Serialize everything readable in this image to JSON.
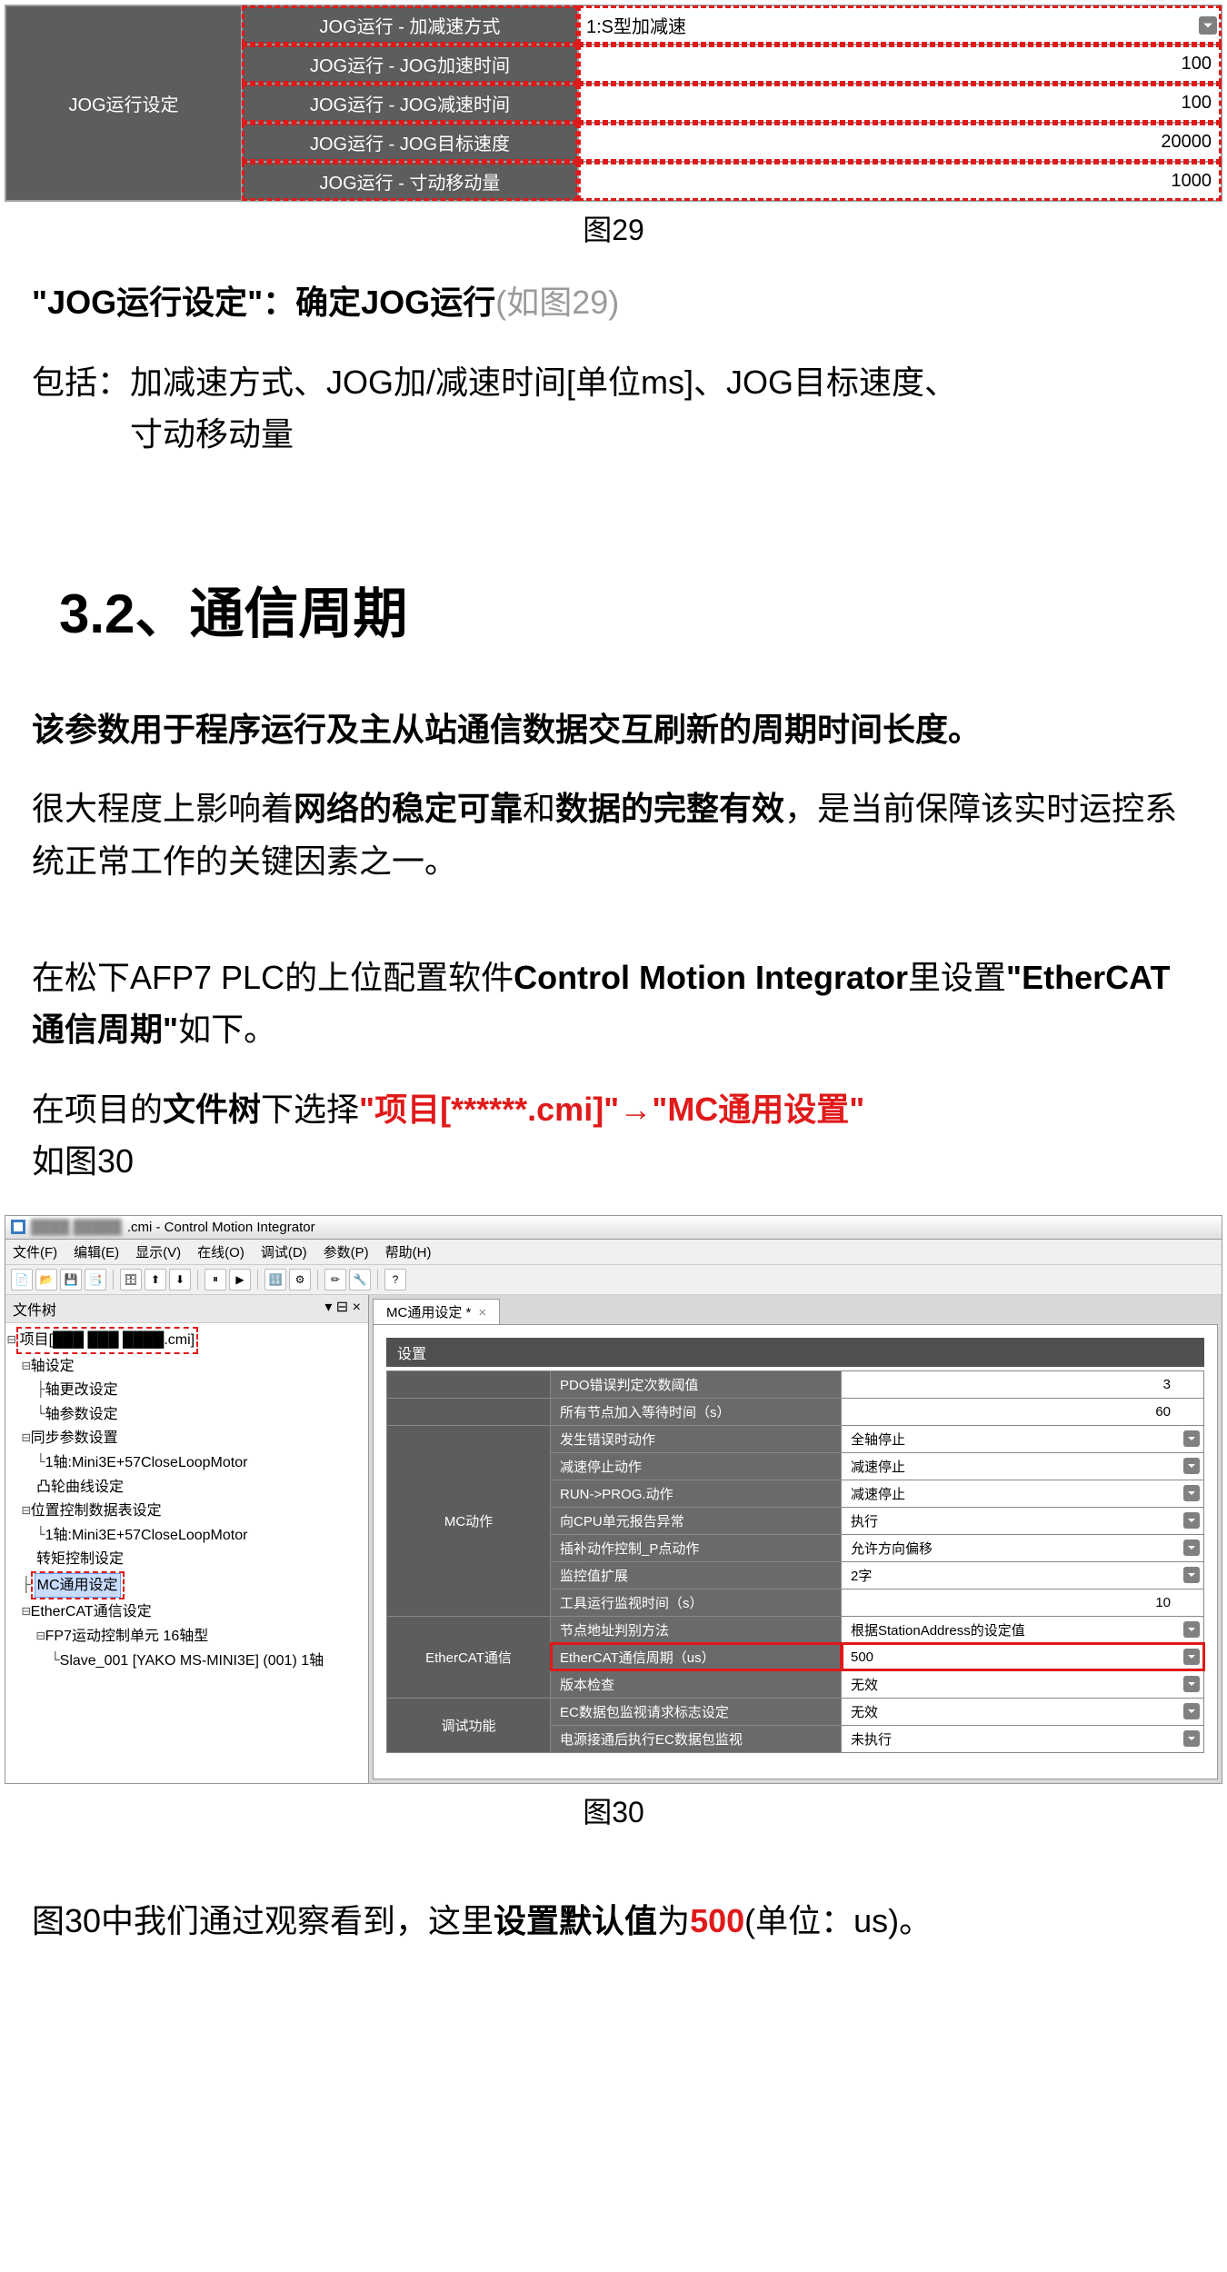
{
  "fig29": {
    "groupLabel": "JOG运行设定",
    "rows": [
      {
        "label": "JOG运行 - 加减速方式",
        "value": "1:S型加减速",
        "align": "left",
        "dd": true
      },
      {
        "label": "JOG运行 - JOG加速时间",
        "value": "100",
        "align": "right"
      },
      {
        "label": "JOG运行 - JOG减速时间",
        "value": "100",
        "align": "right"
      },
      {
        "label": "JOG运行 - JOG目标速度",
        "value": "20000",
        "align": "right"
      },
      {
        "label": "JOG运行 - 寸动移动量",
        "value": "1000",
        "align": "right"
      }
    ],
    "caption": "图29"
  },
  "text": {
    "p1_bold": "\"JOG运行设定\"：确定JOG运行",
    "p1_gray": "(如图29)",
    "p2": "包括：加减速方式、JOG加/减速时间[单位ms]、JOG目标速度、",
    "p2b": "　　　寸动移动量",
    "h2": "3.2、通信周期",
    "p3": "该参数用于程序运行及主从站通信数据交互刷新的周期时间长度。",
    "p4a": "很大程度上影响着",
    "p4b": "网络的稳定可靠",
    "p4c": "和",
    "p4d": "数据的完整有效",
    "p4e": "，是当前保障该实时运控系统正常工作的关键因素之一。",
    "p5a": "在松下AFP7 PLC的上位配置软件",
    "p5b": "Control Motion Integrator",
    "p5c": "里设置",
    "p5d": "\"EtherCAT通信周期\"",
    "p5e": "如下。",
    "p6a": "在项目的",
    "p6b": "文件树",
    "p6c": "下选择",
    "p6d": "\"项目[******.cmi]\"→\"MC通用设置\"",
    "p6e": "如图30",
    "cap30": "图30",
    "p7a": "图30中我们通过观察看到，这里",
    "p7b": "设置默认值",
    "p7c": "为",
    "p7d": "500",
    "p7e": "(单位：us)。"
  },
  "fig30": {
    "title": ".cmi - Control Motion Integrator",
    "titleBlur": "████ █████",
    "menus": [
      "文件(F)",
      "编辑(E)",
      "显示(V)",
      "在线(O)",
      "调试(D)",
      "参数(P)",
      "帮助(H)"
    ],
    "treeHeader": "文件树",
    "treePin": "▾ ⊟ ×",
    "tree": [
      {
        "ind": "⊟ ",
        "txt": "项目[███ ███ ████.cmi]",
        "box": true
      },
      {
        "ind": "　⊟ ",
        "txt": "轴设定"
      },
      {
        "ind": "　　├ ",
        "txt": "轴更改设定"
      },
      {
        "ind": "　　└ ",
        "txt": "轴参数设定"
      },
      {
        "ind": "　⊟ ",
        "txt": "同步参数设置"
      },
      {
        "ind": "　　└ ",
        "txt": "1轴:Mini3E+57CloseLoopMotor"
      },
      {
        "ind": "　　",
        "txt": "凸轮曲线设定"
      },
      {
        "ind": "　⊟ ",
        "txt": "位置控制数据表设定"
      },
      {
        "ind": "　　└ ",
        "txt": "1轴:Mini3E+57CloseLoopMotor"
      },
      {
        "ind": "　　",
        "txt": "转矩控制设定"
      },
      {
        "ind": "　├ ",
        "txt": "MC通用设定",
        "box": true,
        "hl": true
      },
      {
        "ind": "　⊟ ",
        "txt": "EtherCAT通信设定"
      },
      {
        "ind": "　　⊟ ",
        "txt": "FP7运动控制单元 16轴型"
      },
      {
        "ind": "　　　└ ",
        "txt": "Slave_001 [YAKO MS-MINI3E] (001) 1轴"
      }
    ],
    "tabTitle": "MC通用设定 *",
    "panelHeader": "设置",
    "settings": [
      {
        "g": "",
        "l": "PDO错误判定次数阈值",
        "v": "3",
        "right": true
      },
      {
        "g": "",
        "l": "所有节点加入等待时间（s）",
        "v": "60",
        "right": true
      },
      {
        "g": "MC动作",
        "l": "发生错误时动作",
        "v": "全轴停止",
        "dd": true,
        "gstart": true,
        "gspan": 7
      },
      {
        "g": "",
        "l": "减速停止动作",
        "v": "减速停止",
        "dd": true
      },
      {
        "g": "",
        "l": "RUN->PROG.动作",
        "v": "减速停止",
        "dd": true
      },
      {
        "g": "",
        "l": "向CPU单元报告异常",
        "v": "执行",
        "dd": true
      },
      {
        "g": "",
        "l": "插补动作控制_P点动作",
        "v": "允许方向偏移",
        "dd": true
      },
      {
        "g": "",
        "l": "监控值扩展",
        "v": "2字",
        "dd": true
      },
      {
        "g": "",
        "l": "工具运行监视时间（s）",
        "v": "10",
        "right": true
      },
      {
        "g": "EtherCAT通信",
        "l": "节点地址判别方法",
        "v": "根据StationAddress的设定值",
        "dd": true,
        "gstart": true,
        "gspan": 3
      },
      {
        "g": "",
        "l": "EtherCAT通信周期（us）",
        "v": "500",
        "dd": true,
        "hi": true
      },
      {
        "g": "",
        "l": "版本检查",
        "v": "无效",
        "dd": true
      },
      {
        "g": "调试功能",
        "l": "EC数据包监视请求标志设定",
        "v": "无效",
        "dd": true,
        "gstart": true,
        "gspan": 2
      },
      {
        "g": "",
        "l": "电源接通后执行EC数据包监视",
        "v": "未执行",
        "dd": true
      }
    ]
  }
}
